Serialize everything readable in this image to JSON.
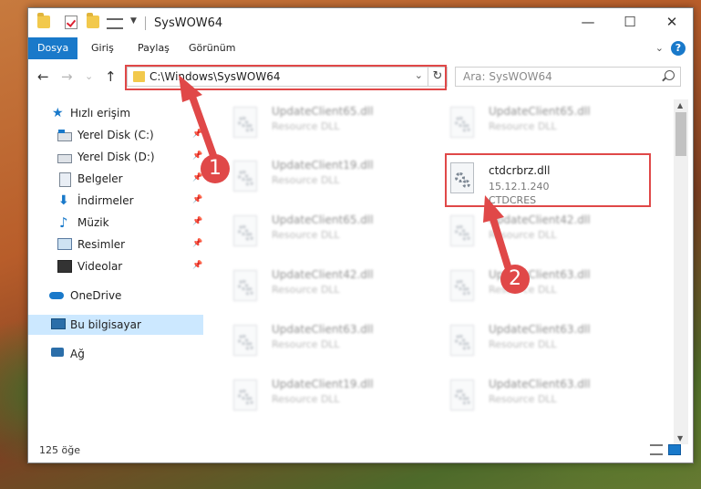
{
  "window": {
    "title": "SysWOW64"
  },
  "window_controls": {
    "minimize": "—",
    "maximize": "☐",
    "close": "✕"
  },
  "ribbon": {
    "tabs": [
      {
        "label": "Dosya",
        "active": true
      },
      {
        "label": "Giriş",
        "active": false
      },
      {
        "label": "Paylaş",
        "active": false
      },
      {
        "label": "Görünüm",
        "active": false
      }
    ],
    "help": "?"
  },
  "nav": {
    "back": "←",
    "forward": "→",
    "recent": "⌄",
    "up": "↑",
    "address": "C:\\Windows\\SysWOW64",
    "refresh": "↻",
    "search_placeholder": "Ara: SysWOW64"
  },
  "sidebar": {
    "items": [
      {
        "label": "Hızlı erişim",
        "icon": "star-icon",
        "pinned": false
      },
      {
        "label": "Yerel Disk (C:)",
        "icon": "drive-c-icon",
        "pinned": true
      },
      {
        "label": "Yerel Disk (D:)",
        "icon": "drive-icon",
        "pinned": true
      },
      {
        "label": "Belgeler",
        "icon": "documents-icon",
        "pinned": true
      },
      {
        "label": "İndirmeler",
        "icon": "downloads-icon",
        "pinned": true
      },
      {
        "label": "Müzik",
        "icon": "music-icon",
        "pinned": true
      },
      {
        "label": "Resimler",
        "icon": "pictures-icon",
        "pinned": true
      },
      {
        "label": "Videolar",
        "icon": "videos-icon",
        "pinned": true
      },
      {
        "label": "OneDrive",
        "icon": "onedrive-icon",
        "pinned": false
      },
      {
        "label": "Bu bilgisayar",
        "icon": "this-pc-icon",
        "pinned": false,
        "selected": true
      },
      {
        "label": "Ağ",
        "icon": "network-icon",
        "pinned": false
      }
    ]
  },
  "files": [
    {
      "name": "UpdateClient65.dll",
      "type": "Resource DLL"
    },
    {
      "name": "UpdateClient65.dll",
      "type": "Resource DLL"
    },
    {
      "name": "UpdateClient19.dll",
      "type": "Resource DLL"
    },
    {
      "name": "ctdcrbrz.dll",
      "version": "15.12.1.240",
      "type": "CTDCRES",
      "highlighted": true
    },
    {
      "name": "UpdateClient65.dll",
      "type": "Resource DLL"
    },
    {
      "name": "UpdateClient42.dll",
      "type": "Resource DLL"
    },
    {
      "name": "UpdateClient42.dll",
      "type": "Resource DLL"
    },
    {
      "name": "UpdateClient63.dll",
      "type": "Resource DLL"
    },
    {
      "name": "UpdateClient63.dll",
      "type": "Resource DLL"
    },
    {
      "name": "UpdateClient63.dll",
      "type": "Resource DLL"
    },
    {
      "name": "UpdateClient19.dll",
      "type": "Resource DLL"
    },
    {
      "name": "UpdateClient63.dll",
      "type": "Resource DLL"
    }
  ],
  "status": {
    "item_count": "125 öğe"
  },
  "annotations": {
    "badge1": "1",
    "badge2": "2",
    "color": "#e04848"
  }
}
